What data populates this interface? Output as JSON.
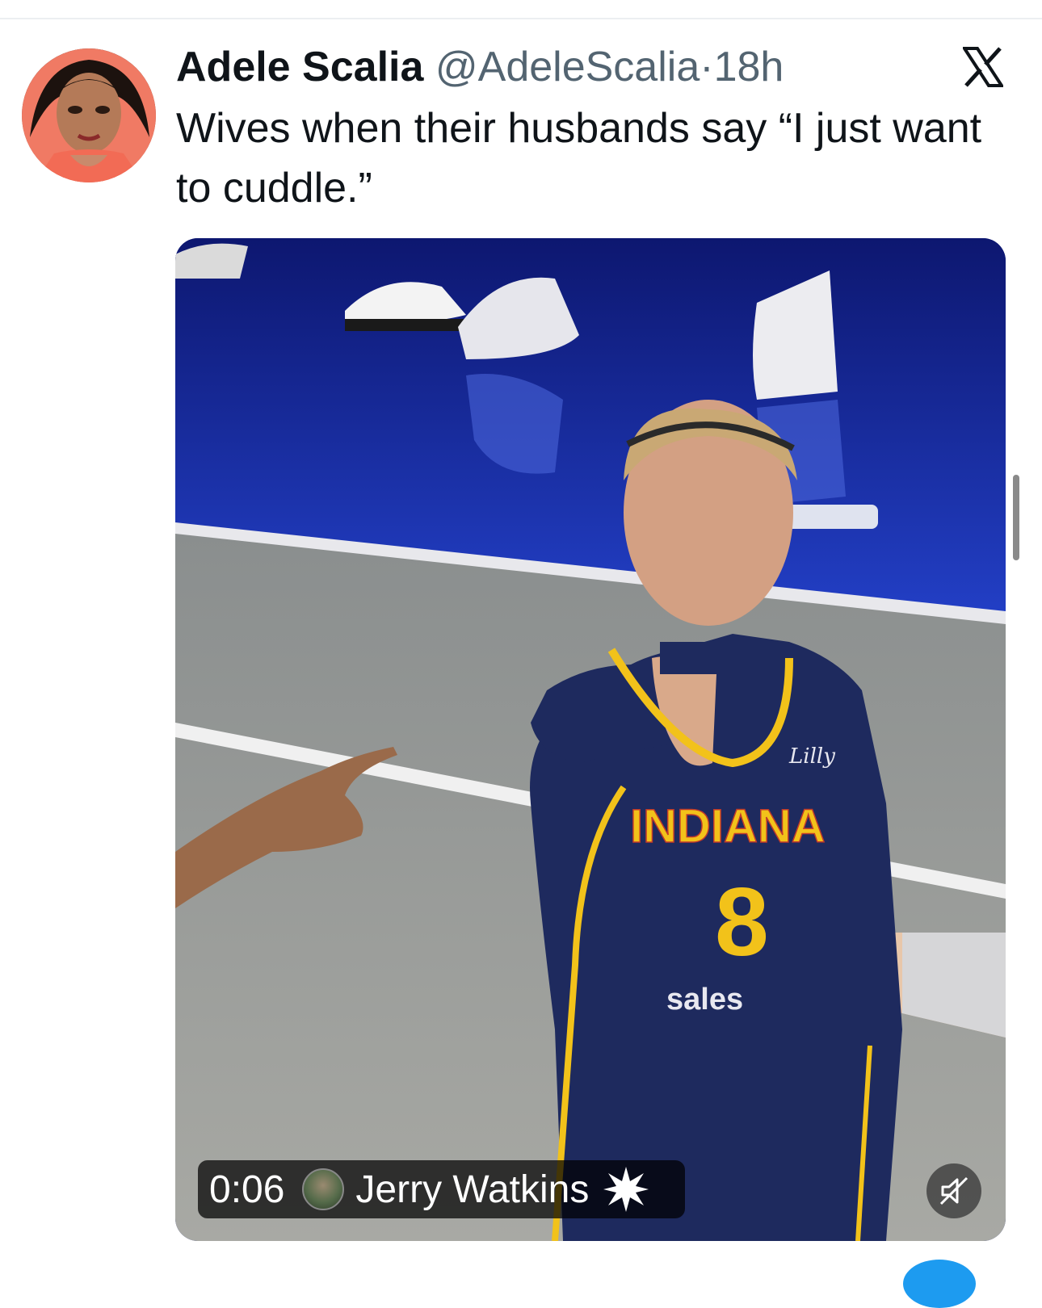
{
  "tweet": {
    "author_name": "Adele Scalia",
    "author_handle": "@AdeleScalia",
    "separator": "·",
    "timestamp": "18h",
    "text": "Wives when their husbands say “I just want to cuddle.”",
    "platform_icon": "x-logo-icon"
  },
  "media": {
    "jersey_team": "INDIANA",
    "jersey_number": "8",
    "video": {
      "elapsed_time": "0:06",
      "source_author": "Jerry Watkins",
      "mute_icon": "speaker-muted-icon"
    }
  },
  "colors": {
    "text_primary": "#0f1419",
    "text_secondary": "#536471",
    "court_blue": "#1b2a8a",
    "jersey_navy": "#1e2a5e",
    "jersey_gold": "#f2c21a",
    "accent": "#1d9bf0"
  }
}
